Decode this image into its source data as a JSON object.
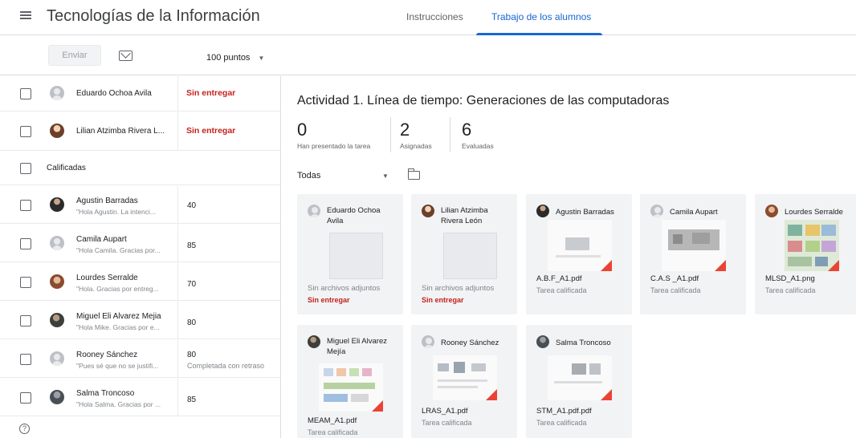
{
  "header": {
    "title": "Tecnologías de la Información",
    "tabs": [
      "Instrucciones",
      "Trabajo de los alumnos"
    ],
    "active_tab": "Trabajo de los alumnos"
  },
  "toolbar": {
    "send_label": "Enviar",
    "points": "100 puntos",
    "caret": "▼"
  },
  "students": [
    {
      "name": "Eduardo Ochoa Avila",
      "comment": "",
      "status": "Sin entregar",
      "grade": "",
      "note": ""
    },
    {
      "name": "Lilian Atzimba Rivera L...",
      "comment": "",
      "status": "Sin entregar",
      "grade": "",
      "note": ""
    },
    {
      "name": "Agustin Barradas",
      "comment": "\"Hola Agustin. La intenci...",
      "status": "",
      "grade": "40",
      "note": ""
    },
    {
      "name": "Camila Aupart",
      "comment": "\"Hola Camila. Gracias por...",
      "status": "",
      "grade": "85",
      "note": ""
    },
    {
      "name": "Lourdes Serralde",
      "comment": "\"Hola. Gracias por entreg...",
      "status": "",
      "grade": "70",
      "note": ""
    },
    {
      "name": "Miguel Eli Alvarez Mejia",
      "comment": "\"Hola Mike. Gracias por e...",
      "status": "",
      "grade": "80",
      "note": ""
    },
    {
      "name": "Rooney Sánchez",
      "comment": "\"Pues sé que no se justifi...",
      "status": "",
      "grade": "80",
      "note": "Completada con retraso"
    },
    {
      "name": "Salma Troncoso",
      "comment": "\"Hola Salma. Gracias por ...",
      "status": "",
      "grade": "85",
      "note": ""
    }
  ],
  "section_graded": "Calificadas",
  "help_glyph": "?",
  "assignment": {
    "title": "Actividad 1. Línea de tiempo: Generaciones de las computadoras",
    "stats": [
      {
        "value": "0",
        "label": "Han presentado la tarea"
      },
      {
        "value": "2",
        "label": "Asignadas"
      },
      {
        "value": "6",
        "label": "Evaluadas"
      }
    ],
    "filter": "Todas",
    "filter_caret": "▼"
  },
  "cards": [
    {
      "name": "Eduardo Ochoa Avila",
      "line1": "Sin archivos adjuntos",
      "line2": "Sin entregar"
    },
    {
      "name": "Lilian Atzimba Rivera León",
      "line1": "Sin archivos adjuntos",
      "line2": "Sin entregar"
    },
    {
      "name": "Agustin Barradas",
      "line1": "A.B.F_A1.pdf",
      "line2": "Tarea calificada"
    },
    {
      "name": "Camila Aupart",
      "line1": "C.A.S _A1.pdf",
      "line2": "Tarea calificada"
    },
    {
      "name": "Lourdes Serralde",
      "line1": "MLSD_A1.png",
      "line2": "Tarea calificada"
    },
    {
      "name": "Miguel Eli Alvarez Mejía",
      "line1": "MEAM_A1.pdf",
      "line2": "Tarea calificada"
    },
    {
      "name": "Rooney Sánchez",
      "line1": "LRAS_A1.pdf",
      "line2": "Tarea calificada"
    },
    {
      "name": "Salma Troncoso",
      "line1": "STM_A1.pdf.pdf",
      "line2": "Tarea calificada"
    }
  ],
  "colors": {
    "accent": "#1967d2",
    "status_red": "#c5221f",
    "card_bg": "#f1f3f4"
  }
}
